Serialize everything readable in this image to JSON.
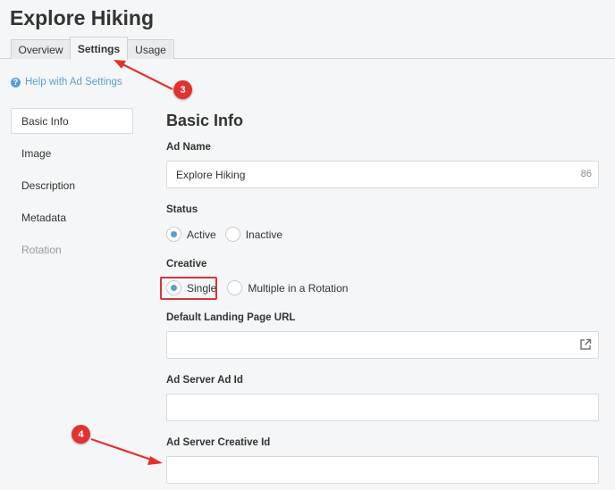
{
  "page": {
    "title": "Explore Hiking"
  },
  "tabs": [
    {
      "label": "Overview",
      "active": false
    },
    {
      "label": "Settings",
      "active": true
    },
    {
      "label": "Usage",
      "active": false
    }
  ],
  "help": {
    "label": "Help with Ad Settings",
    "icon": "question-circle-icon"
  },
  "sidebar": {
    "items": [
      {
        "label": "Basic Info",
        "active": true
      },
      {
        "label": "Image"
      },
      {
        "label": "Description"
      },
      {
        "label": "Metadata"
      },
      {
        "label": "Rotation",
        "disabled": true
      }
    ]
  },
  "basic_info": {
    "title": "Basic Info",
    "ad_name": {
      "label": "Ad Name",
      "value": "Explore Hiking",
      "char_count": "86"
    },
    "status": {
      "label": "Status",
      "options": [
        "Active",
        "Inactive"
      ],
      "selected": "Active"
    },
    "creative": {
      "label": "Creative",
      "options": [
        "Single",
        "Multiple in a Rotation"
      ],
      "selected": "Single"
    },
    "landing_url": {
      "label": "Default Landing Page URL",
      "value": "",
      "icon": "external-link-icon"
    },
    "ad_server_ad_id": {
      "label": "Ad Server Ad Id",
      "value": ""
    },
    "ad_server_creative_id": {
      "label": "Ad Server Creative Id",
      "value": ""
    }
  },
  "annotations": [
    {
      "label": "3",
      "points_to": "tab-settings"
    },
    {
      "label": "4",
      "points_to": "ad-server-creative-id-input"
    }
  ],
  "colors": {
    "accent": "#5a9fd0",
    "annotation": "#e0332f",
    "background": "#f5f6f7"
  }
}
